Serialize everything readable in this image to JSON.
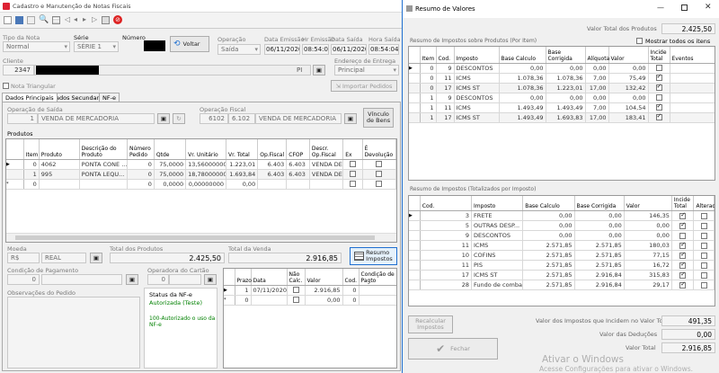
{
  "main_window": {
    "title": "Cadastro e Manutenção de Notas Fiscais",
    "tipo_nota": {
      "label": "Tipo da Nota",
      "value": "Normal"
    },
    "serie": {
      "label": "Série",
      "value": "SÉRIE 1"
    },
    "numero": {
      "label": "Número"
    },
    "voltar_label": "Voltar",
    "operacao": {
      "label": "Operação",
      "value": "Saída"
    },
    "data_emissao": {
      "label": "Data Emissão",
      "value": "06/11/2020"
    },
    "hr_emissao": {
      "label": "Hr Emissão",
      "value": "08:54:04"
    },
    "data_saida": {
      "label": "Data Saída",
      "value": "06/11/2020"
    },
    "hora_saida": {
      "label": "Hora Saída",
      "value": "08:54:04"
    },
    "cliente": {
      "label": "Cliente",
      "code": "2347",
      "uf": "PI"
    },
    "endereco_entrega": {
      "label": "Endereço de Entrega",
      "value": "Principal"
    },
    "nota_triangular": "Nota Triangular",
    "importar_pedidos": "Importar Pedidos",
    "tabs": [
      "Dados Principais",
      "Dados Secundarios",
      "NF-e"
    ],
    "operacao_saida": {
      "label": "Operação de Saída",
      "code": "1",
      "value": "VENDA DE MERCADORIA"
    },
    "operacao_fiscal": {
      "label": "Operação Fiscal",
      "code": "6102",
      "cfop": "6.102",
      "value": "VENDA DE MERCADORIA"
    },
    "vinculo_bens": [
      "Vínculo",
      "de Bens"
    ],
    "produtos_label": "Produtos",
    "prod_headers": [
      "Item",
      "Produto",
      "Descrição do Produto",
      "Número Pedido",
      "Qtde",
      "Vr. Unitário",
      "Vr. Total",
      "Op.Fiscal",
      "CFOP",
      "Descr. Op.Fiscal",
      "Ex",
      "É Devolução"
    ],
    "prod_rows": [
      [
        "0",
        "4062",
        "PONTA CONE ...",
        "0",
        "75,0000",
        "13,56000000",
        "1.223,01",
        "6.403",
        "6.403",
        "VENDA DE...",
        "",
        ""
      ],
      [
        "1",
        "995",
        "PONTA LEQU...",
        "0",
        "75,0000",
        "18,78000000",
        "1.693,84",
        "6.403",
        "6.403",
        "VENDA DE...",
        "",
        ""
      ],
      [
        "0",
        "",
        "",
        "0",
        "0,0000",
        "0,00000000",
        "0,00",
        "",
        "",
        "",
        "",
        ""
      ]
    ],
    "moeda": {
      "label": "Moeda",
      "code": "R$",
      "value": "REAL"
    },
    "total_produtos": {
      "label": "Total dos Produtos",
      "value": "2.425,50"
    },
    "total_venda": {
      "label": "Total da Venda",
      "value": "2.916,85"
    },
    "resumo_impostos": [
      "Resumo",
      "Impostos"
    ],
    "condicao_pagamento": {
      "label": "Condição de Pagamento",
      "value": "0"
    },
    "operadora_cartao": {
      "label": "Operadora do Cartão",
      "value": "0"
    },
    "observacoes": "Observações do Pedido",
    "status": {
      "label": "Status da NF-e",
      "value": "Autorizada (Teste)",
      "message": "100-Autorizado o uso da NF-e"
    },
    "parc_headers": [
      "Prazo",
      "Data",
      "Não Calc.",
      "Valor",
      "Cod.",
      "Condição de Pagto"
    ],
    "parc_rows": [
      [
        "1",
        "07/11/2020",
        "",
        "2.916,85",
        "0",
        ""
      ],
      [
        "0",
        "",
        "",
        "0,00",
        "0",
        ""
      ]
    ]
  },
  "resumo": {
    "title": "Resumo de Valores",
    "valor_total_produtos": {
      "label": "Valor Total dos Produtos",
      "value": "2.425,50"
    },
    "sobre_produtos_label": "Resumo de Impostos sobre Produtos (Por Item)",
    "mostrar_todos": "Mostrar todos os itens",
    "item_headers": [
      "Item",
      "Cod.",
      "Imposto",
      "Base Calculo",
      "Base Corrigida",
      "Alíquota",
      "Valor",
      "Incide Total",
      "Eventos"
    ],
    "item_rows": [
      {
        "c": [
          "0",
          "9",
          "DESCONTOS",
          "0,00",
          "0,00",
          "0,00",
          "0,00"
        ],
        "inc": false,
        "g": false
      },
      {
        "c": [
          "0",
          "11",
          "ICMS",
          "1.078,36",
          "1.078,36",
          "7,00",
          "75,49"
        ],
        "inc": true,
        "g": false
      },
      {
        "c": [
          "0",
          "17",
          "ICMS ST",
          "1.078,36",
          "1.223,01",
          "17,00",
          "132,42"
        ],
        "inc": true,
        "g": true
      },
      {
        "c": [
          "1",
          "9",
          "DESCONTOS",
          "0,00",
          "0,00",
          "0,00",
          "0,00"
        ],
        "inc": false,
        "g": false
      },
      {
        "c": [
          "1",
          "11",
          "ICMS",
          "1.493,49",
          "1.493,49",
          "7,00",
          "104,54"
        ],
        "inc": true,
        "g": false
      },
      {
        "c": [
          "1",
          "17",
          "ICMS ST",
          "1.493,49",
          "1.693,83",
          "17,00",
          "183,41"
        ],
        "inc": true,
        "g": true
      }
    ],
    "totalizados_label": "Resumo de Impostos (Totalizados por Imposto)",
    "tot_headers": [
      "Cod.",
      "Imposto",
      "Base Calculo",
      "Base Corrigida",
      "Valor",
      "Incide Total",
      "Alterado"
    ],
    "tot_rows": [
      {
        "c": [
          "3",
          "FRETE",
          "0,00",
          "0,00",
          "146,35"
        ],
        "inc": true
      },
      {
        "c": [
          "5",
          "OUTRAS DESP...",
          "0,00",
          "0,00",
          "0,00"
        ],
        "inc": true
      },
      {
        "c": [
          "9",
          "DESCONTOS",
          "0,00",
          "0,00",
          "0,00"
        ],
        "inc": false
      },
      {
        "c": [
          "11",
          "ICMS",
          "2.571,85",
          "2.571,85",
          "180,03"
        ],
        "inc": true
      },
      {
        "c": [
          "10",
          "COFINS",
          "2.571,85",
          "2.571,85",
          "77,15"
        ],
        "inc": true
      },
      {
        "c": [
          "11",
          "PIS",
          "2.571,85",
          "2.571,85",
          "16,72"
        ],
        "inc": true
      },
      {
        "c": [
          "17",
          "ICMS ST",
          "2.571,85",
          "2.916,84",
          "315,83"
        ],
        "inc": true
      },
      {
        "c": [
          "28",
          "Fundo de combat...",
          "2.571,85",
          "2.916,84",
          "29,17"
        ],
        "inc": true
      }
    ],
    "recalcular": [
      "Recalcular",
      "Impostos"
    ],
    "fechar": "Fechar",
    "valor_impostos": {
      "label": "Valor dos Impostos que Incidem no Valor Total",
      "value": "491,35"
    },
    "valor_deducoes": {
      "label": "Valor das Deduções",
      "value": "0,00"
    },
    "valor_total": {
      "label": "Valor Total",
      "value": "2.916,85"
    }
  },
  "watermark": {
    "title": "Ativar o Windows",
    "subtitle": "Acesse Configurações para ativar o Windows."
  },
  "colors": {
    "status_green": "#008000",
    "accent": "#1f6fd0"
  }
}
